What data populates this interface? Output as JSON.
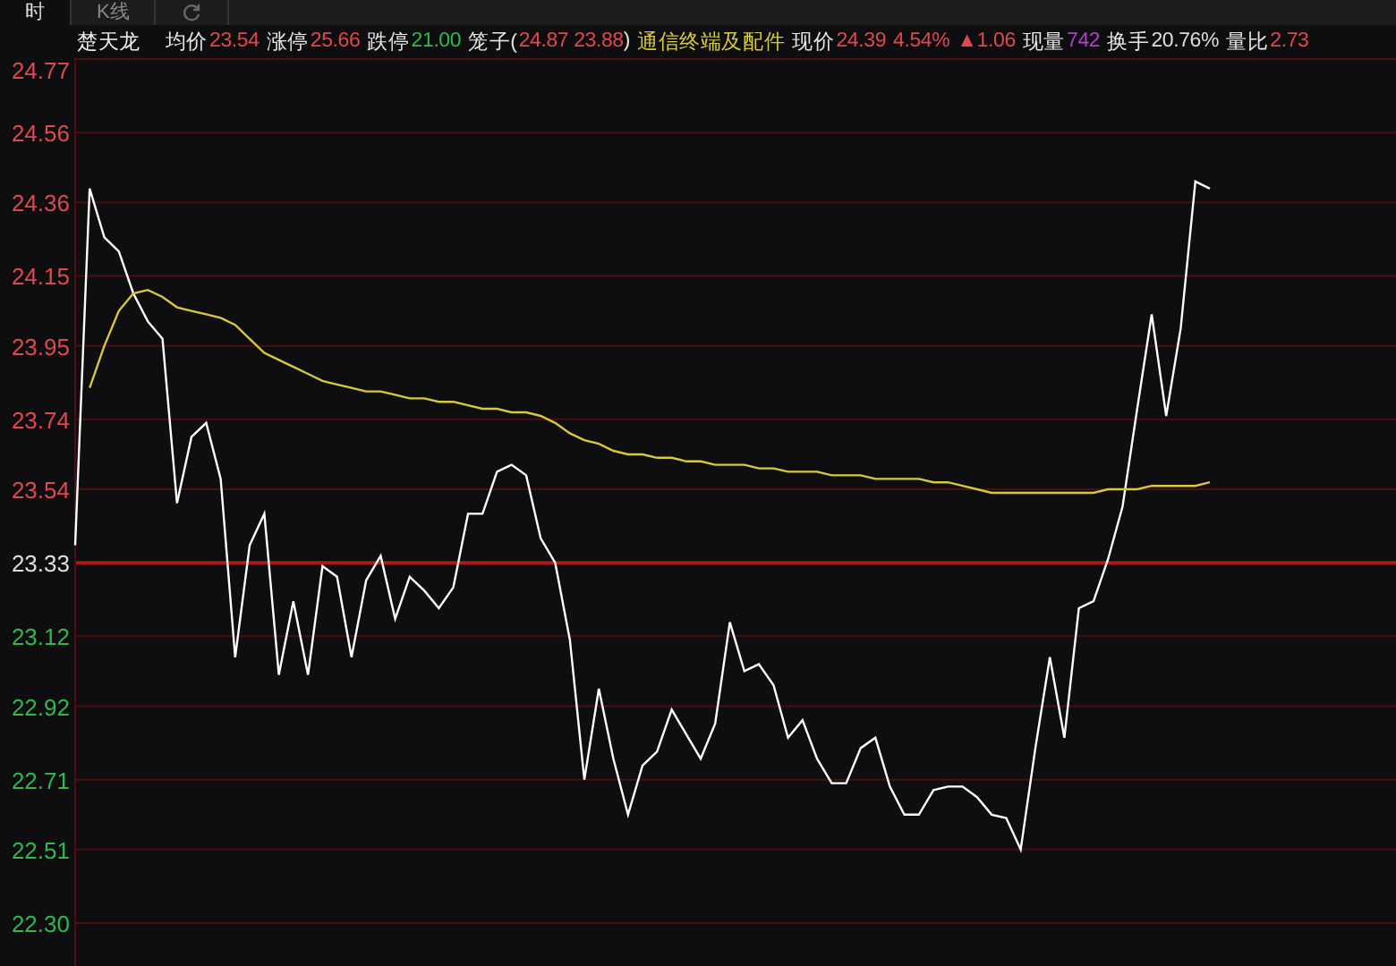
{
  "tabs": [
    {
      "label": "时",
      "selected": true
    },
    {
      "label": "K线",
      "selected": false
    },
    {
      "kind": "icon",
      "selected": false
    }
  ],
  "header": {
    "name": "楚天龙",
    "fields": [
      {
        "label": "均价",
        "value": "23.54",
        "color": "#e0484b"
      },
      {
        "label": "涨停",
        "value": "25.66",
        "color": "#e0484b"
      },
      {
        "label": "跌停",
        "value": "21.00",
        "color": "#2eb84e"
      },
      {
        "label": "笼子(",
        "value": "24.87 23.88",
        "suffix": ")",
        "color": "#e0484b"
      },
      {
        "value": "通信终端及配件",
        "color": "#d6c93a"
      },
      {
        "label": "现价",
        "value": "24.39",
        "color": "#e0484b"
      },
      {
        "value": "4.54%",
        "color": "#e0484b"
      },
      {
        "value": "▲1.06",
        "color": "#e0484b"
      },
      {
        "label": "现量",
        "value": "742",
        "color": "#b040c8"
      },
      {
        "label": "换手",
        "value": "20.76%",
        "color": "#dddddd"
      },
      {
        "label": "量比",
        "value": "2.73",
        "color": "#e0484b"
      }
    ]
  },
  "chart": {
    "chart_data": {
      "type": "line",
      "categories": [
        null,
        null,
        null,
        null,
        null,
        null,
        null,
        null,
        null,
        null,
        null,
        null,
        null,
        null,
        null,
        null,
        null,
        null,
        null,
        null,
        null,
        null,
        null,
        null,
        null,
        null,
        null,
        null,
        null,
        null,
        null,
        null,
        null,
        null,
        null,
        null,
        null,
        null,
        null,
        null,
        null,
        null,
        null,
        null,
        null,
        null,
        null,
        null,
        null,
        null,
        null,
        null,
        null,
        null,
        null,
        null,
        null,
        null,
        null,
        null,
        null,
        null,
        null,
        null,
        null,
        null,
        null,
        null,
        null,
        null,
        null,
        null,
        null,
        null,
        null,
        null,
        null,
        null,
        null
      ],
      "ylim": [
        22.3,
        24.77
      ],
      "yticks": [
        {
          "value": 24.77,
          "label": "24.77"
        },
        {
          "value": 24.56,
          "label": "24.56"
        },
        {
          "value": 24.36,
          "label": "24.36"
        },
        {
          "value": 24.15,
          "label": "24.15"
        },
        {
          "value": 23.95,
          "label": "23.95"
        },
        {
          "value": 23.74,
          "label": "23.74"
        },
        {
          "value": 23.54,
          "label": "23.54"
        },
        {
          "value": 23.33,
          "label": "23.33"
        },
        {
          "value": 23.12,
          "label": "23.12"
        },
        {
          "value": 22.92,
          "label": "22.92"
        },
        {
          "value": 22.71,
          "label": "22.71"
        },
        {
          "value": 22.51,
          "label": "22.51"
        },
        {
          "value": 22.3,
          "label": "22.30"
        }
      ],
      "ref_lines": [
        {
          "axis": "y",
          "value": 23.33
        }
      ],
      "grid": true,
      "series": [
        {
          "color": "#ffffff",
          "values": [
            23.38,
            24.4,
            24.26,
            24.22,
            24.1,
            24.02,
            23.97,
            23.5,
            23.69,
            23.73,
            23.57,
            23.06,
            23.38,
            23.47,
            23.01,
            23.22,
            23.01,
            23.32,
            23.29,
            23.06,
            23.28,
            23.35,
            23.17,
            23.29,
            23.25,
            23.2,
            23.26,
            23.47,
            23.47,
            23.59,
            23.61,
            23.58,
            23.4,
            23.33,
            23.11,
            22.71,
            22.97,
            22.77,
            22.61,
            22.75,
            22.79,
            22.91,
            22.84,
            22.77,
            22.87,
            23.16,
            23.02,
            23.04,
            22.98,
            22.83,
            22.88,
            22.77,
            22.7,
            22.7,
            22.8,
            22.83,
            22.69,
            22.61,
            22.61,
            22.68,
            22.69,
            22.69,
            22.66,
            22.61,
            22.6,
            22.51,
            22.8,
            23.06,
            22.83,
            23.2,
            23.22,
            23.34,
            23.49,
            23.77,
            24.04,
            23.75,
            24.0,
            24.42,
            24.4
          ]
        },
        {
          "color": "#d8c83a",
          "values": [
            null,
            23.83,
            23.95,
            24.05,
            24.1,
            24.11,
            24.09,
            24.06,
            24.05,
            24.04,
            24.03,
            24.01,
            23.97,
            23.93,
            23.91,
            23.89,
            23.87,
            23.85,
            23.84,
            23.83,
            23.82,
            23.82,
            23.81,
            23.8,
            23.8,
            23.79,
            23.79,
            23.78,
            23.77,
            23.77,
            23.76,
            23.76,
            23.75,
            23.73,
            23.7,
            23.68,
            23.67,
            23.65,
            23.64,
            23.64,
            23.63,
            23.63,
            23.62,
            23.62,
            23.61,
            23.61,
            23.61,
            23.6,
            23.6,
            23.59,
            23.59,
            23.59,
            23.58,
            23.58,
            23.58,
            23.57,
            23.57,
            23.57,
            23.57,
            23.56,
            23.56,
            23.55,
            23.54,
            23.53,
            23.53,
            23.53,
            23.53,
            23.53,
            23.53,
            23.53,
            23.53,
            23.54,
            23.54,
            23.54,
            23.55,
            23.55,
            23.55,
            23.55,
            23.56
          ]
        }
      ]
    }
  }
}
